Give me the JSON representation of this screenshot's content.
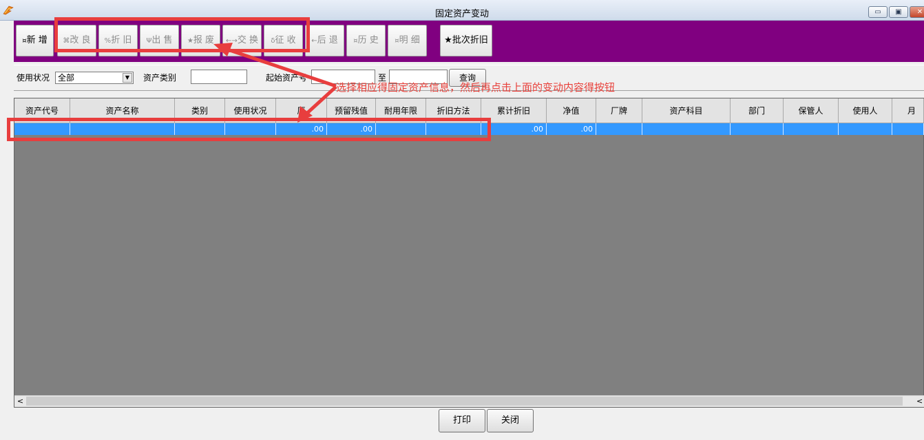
{
  "window": {
    "title": "固定资产变动",
    "min": "▭",
    "max": "▣",
    "close": "✕"
  },
  "toolbar": {
    "buttons": [
      {
        "glyph": "¤",
        "label": "新 增"
      },
      {
        "glyph": "⌘",
        "label": "改 良"
      },
      {
        "glyph": "%",
        "label": "折 旧"
      },
      {
        "glyph": "Ψ",
        "label": "出 售"
      },
      {
        "glyph": "★",
        "label": "报 废"
      },
      {
        "glyph": "←→",
        "label": "交 换"
      },
      {
        "glyph": "δ",
        "label": "征 收"
      },
      {
        "glyph": "←",
        "label": "后 退"
      },
      {
        "glyph": "¤",
        "label": "历 史"
      },
      {
        "glyph": "¤",
        "label": "明 细"
      },
      {
        "glyph": "★",
        "label": "批次折旧"
      }
    ]
  },
  "filter": {
    "status_label": "使用状况",
    "status_value": "全部",
    "category_label": "资产类别",
    "start_no_label": "起始资产号",
    "to_label": "至",
    "query_button": "查询"
  },
  "table": {
    "columns": [
      "资产代号",
      "资产名称",
      "类别",
      "使用状况",
      "原",
      "预留残值",
      "耐用年限",
      "折旧方法",
      "累计折旧",
      "净值",
      "厂牌",
      "资产科目",
      "部门",
      "保管人",
      "使用人",
      "月数"
    ],
    "rows": [
      [
        "",
        "",
        "",
        "",
        ".00",
        ".00",
        "",
        "",
        ".00",
        ".00",
        "",
        "",
        "",
        "",
        "",
        ""
      ]
    ]
  },
  "scrollbar": {
    "left_arrow": "<",
    "right_arrow": "<"
  },
  "bottom": {
    "print_button": "打印",
    "close_button": "关闭"
  },
  "annotation": {
    "text": "选择相应得固定资产信息，然后再点击上面的变动内容得按钮",
    "color": "#e8403a"
  },
  "colors": {
    "toolbar_bg": "#800080",
    "selection": "#3399ff",
    "grid_bg": "#808080"
  }
}
